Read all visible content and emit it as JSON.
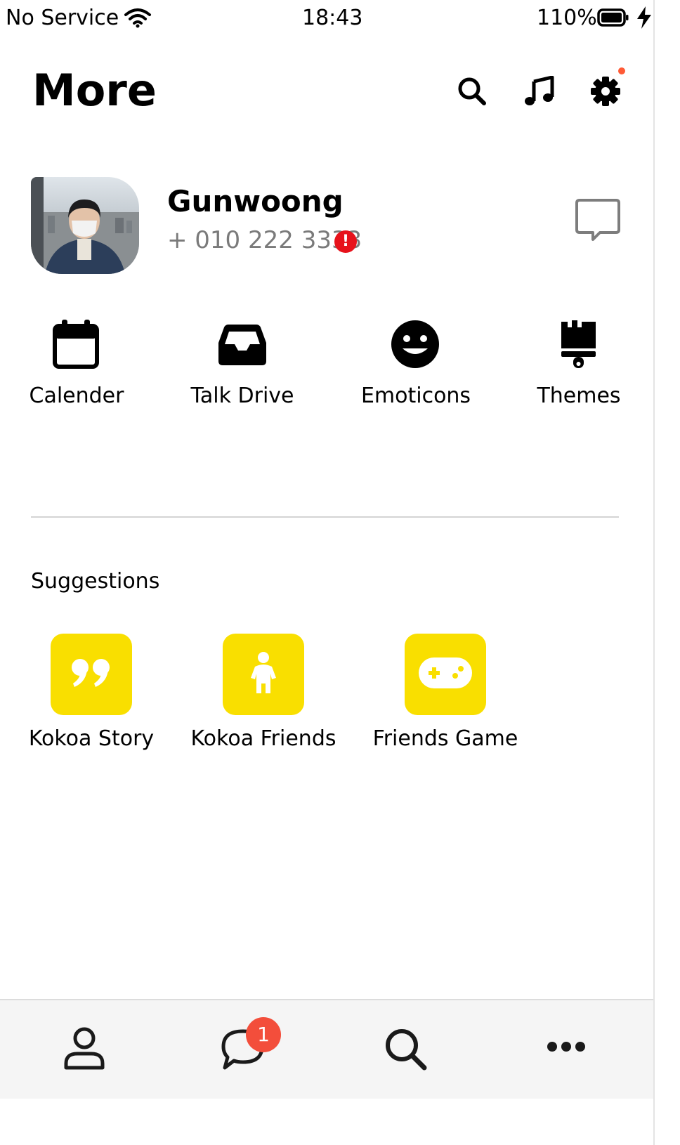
{
  "status_bar": {
    "carrier": "No Service",
    "time": "18:43",
    "battery": "110%"
  },
  "header": {
    "title": "More"
  },
  "profile": {
    "name": "Gunwoong",
    "phone": "+ 010 222 3333",
    "alert": "!"
  },
  "quick_actions": [
    {
      "label": "Calender",
      "icon": "calendar-icon"
    },
    {
      "label": "Talk Drive",
      "icon": "inbox-icon"
    },
    {
      "label": "Emoticons",
      "icon": "smile-icon"
    },
    {
      "label": "Themes",
      "icon": "paintbrush-icon"
    }
  ],
  "suggestions": {
    "title": "Suggestions",
    "items": [
      {
        "label": "Kokoa Story",
        "icon": "quote-icon"
      },
      {
        "label": "Kokoa Friends",
        "icon": "child-icon"
      },
      {
        "label": "Friends Game",
        "icon": "gamepad-icon"
      }
    ]
  },
  "bottom_nav": {
    "items": [
      "person-icon",
      "chat-icon",
      "search-icon",
      "more-icon"
    ],
    "chat_badge": "1"
  },
  "colors": {
    "accent_yellow": "#f9df00",
    "badge_red": "#f34e3b",
    "alert_red": "#e7121b",
    "muted_text": "#7a7a7a"
  }
}
